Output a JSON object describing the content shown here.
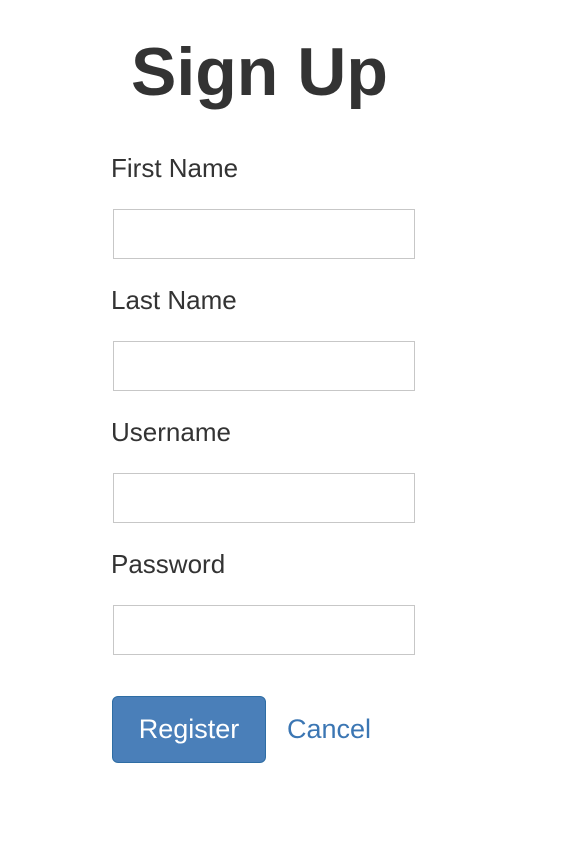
{
  "form": {
    "title": "Sign Up",
    "fields": [
      {
        "label": "First Name",
        "value": "",
        "placeholder": ""
      },
      {
        "label": "Last Name",
        "value": "",
        "placeholder": ""
      },
      {
        "label": "Username",
        "value": "",
        "placeholder": ""
      },
      {
        "label": "Password",
        "value": "",
        "placeholder": ""
      }
    ],
    "register_label": "Register",
    "cancel_label": "Cancel"
  },
  "colors": {
    "primary_button": "#4a7fb9",
    "link": "#3b76b3",
    "text": "#333333",
    "input_border": "#c7c7c7"
  }
}
